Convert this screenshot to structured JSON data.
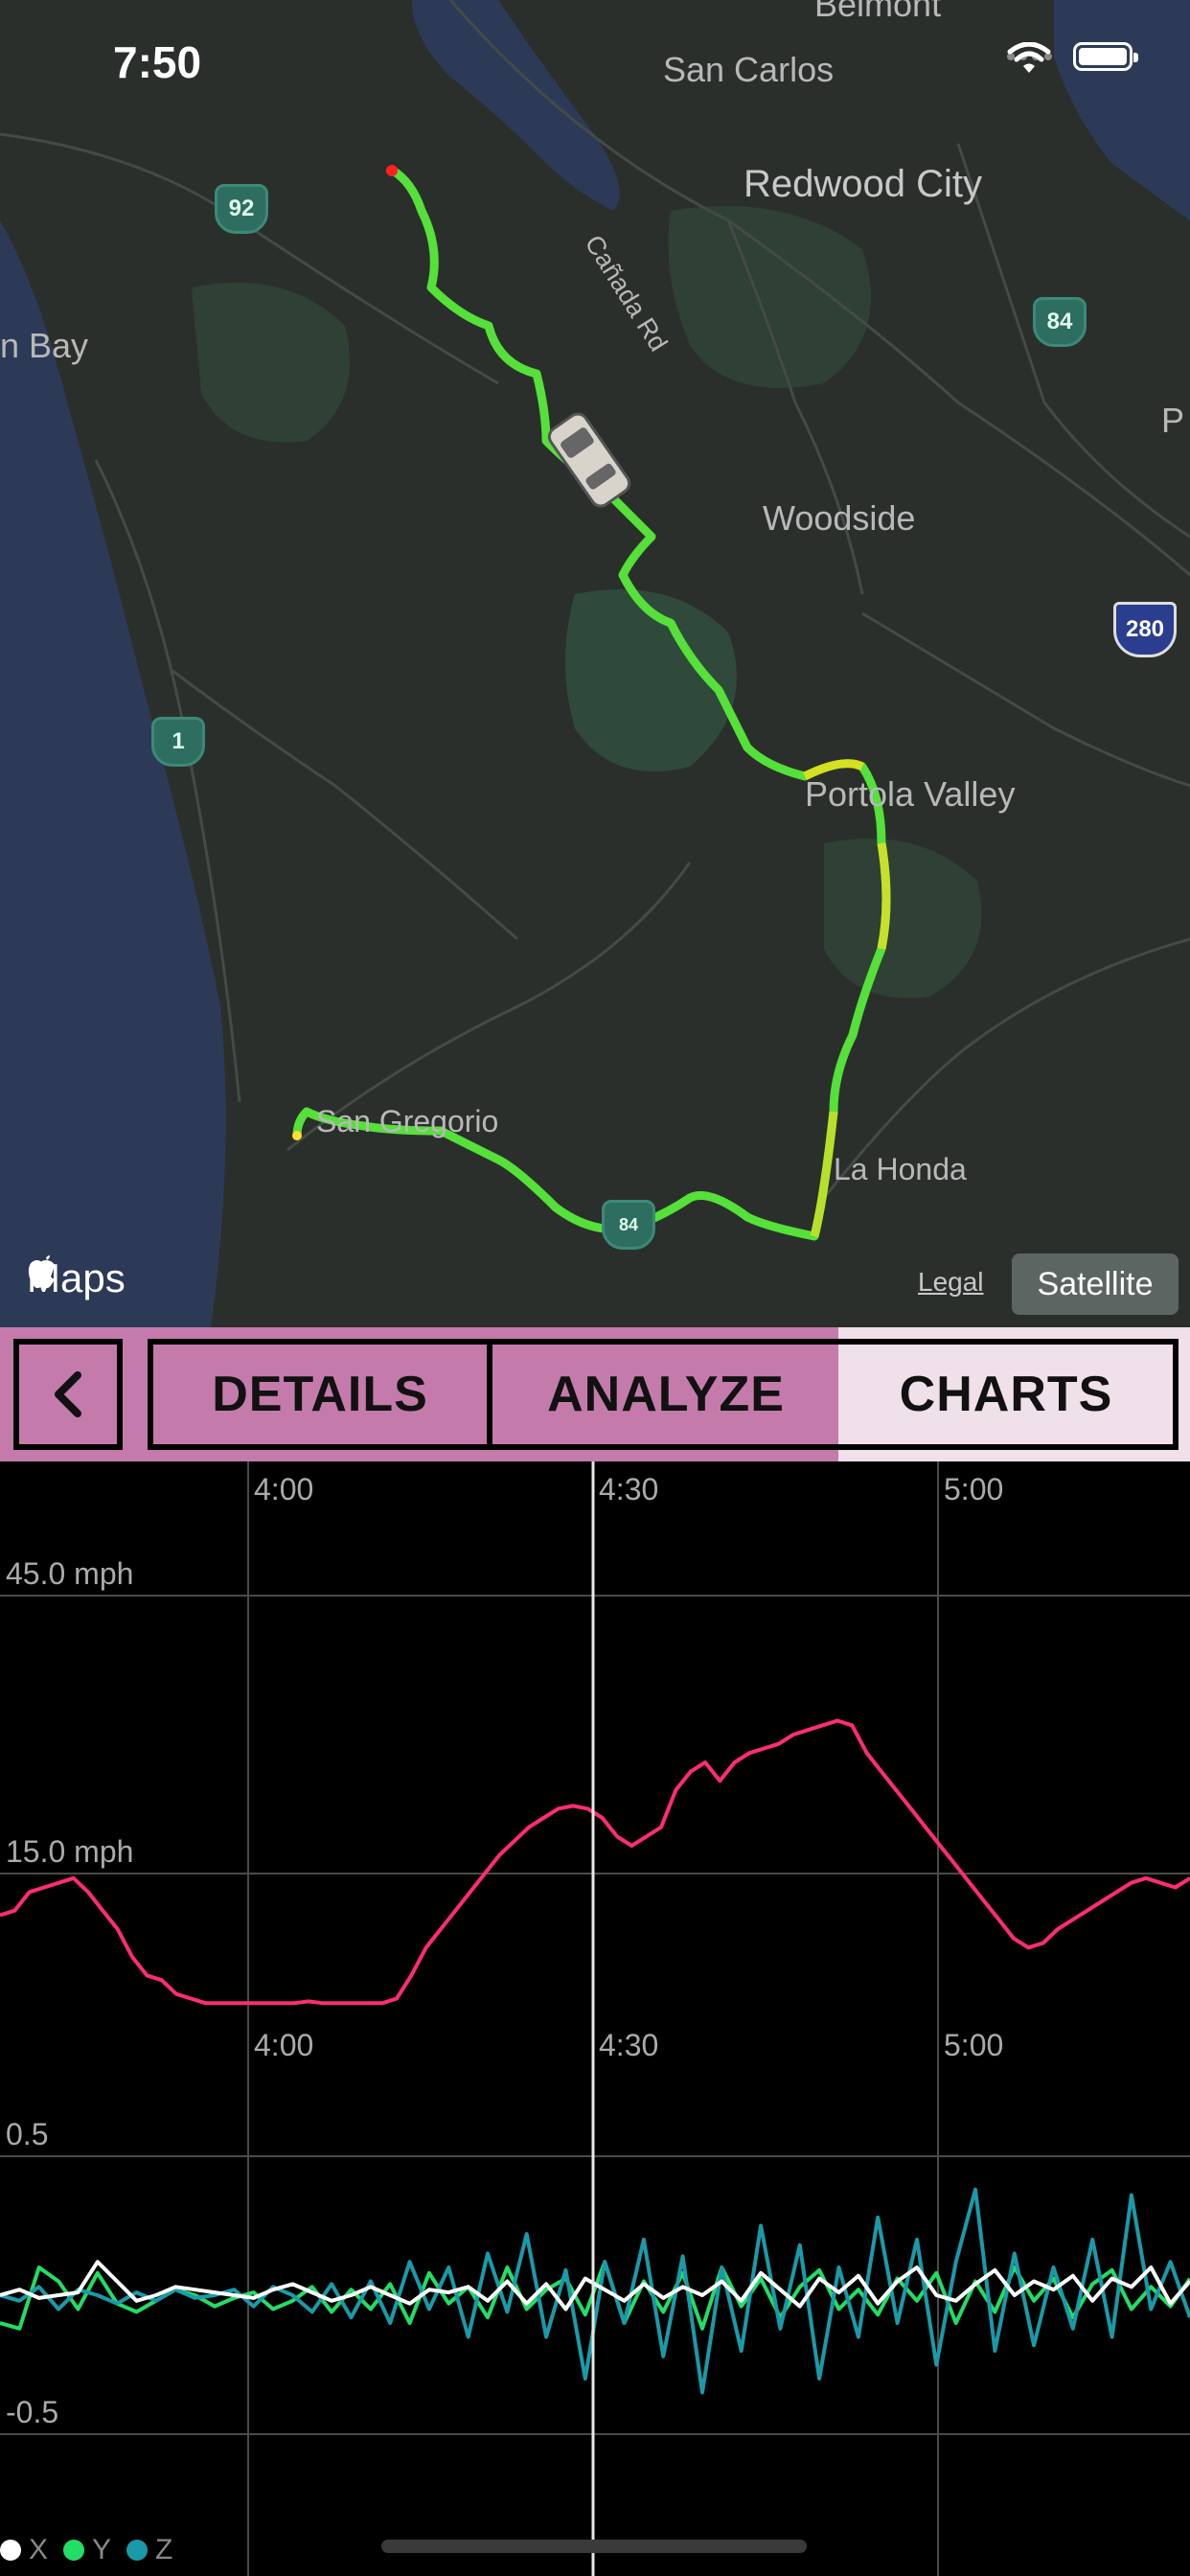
{
  "status_bar": {
    "time": "7:50"
  },
  "map": {
    "labels": {
      "belmont": "Belmont",
      "san_carlos": "San Carlos",
      "redwood_city": "Redwood City",
      "canada_rd": "Cañada Rd",
      "half_moon_bay": "n Bay",
      "woodside": "Woodside",
      "portola_valley": "Portola Valley",
      "san_gregorio": "San Gregorio",
      "la_honda": "La Honda",
      "edge_p": "P"
    },
    "shields": {
      "route92": "92",
      "route84": "84",
      "route1": "1",
      "route280": "280",
      "route84b": "84"
    },
    "logo": "Maps",
    "legal": "Legal",
    "satellite": "Satellite"
  },
  "tabs": {
    "details": "DETAILS",
    "analyze": "ANALYZE",
    "charts": "CHARTS",
    "active": "charts"
  },
  "colors": {
    "accent": "#c47bab",
    "tab_active": "#f0e0ea",
    "speed_line": "#ff2d6f",
    "x_line": "#ffffff",
    "y_line": "#22dd66",
    "z_line": "#1a9aa8",
    "grid": "#4a4a4a"
  },
  "chart_data": [
    {
      "type": "line",
      "title": "",
      "xlabel": "",
      "ylabel": "",
      "x_tick_labels": [
        "4:00",
        "4:30",
        "5:00"
      ],
      "y_tick_labels": [
        "45.0 mph",
        "15.0 mph"
      ],
      "ylim": [
        -15,
        45
      ],
      "cursor_time": "4:30",
      "series": [
        {
          "values": [
            10.5,
            11,
            13,
            13.5,
            14,
            14.5,
            13,
            11,
            9,
            6,
            4,
            3.5,
            2,
            1.5,
            1,
            1,
            1,
            1,
            1,
            1,
            1,
            1.2,
            1,
            1,
            1,
            1,
            1,
            1.5,
            4,
            7,
            9,
            11,
            13,
            15,
            17,
            18.5,
            20,
            21,
            22,
            22.3,
            22,
            21,
            19,
            18,
            19,
            20,
            24,
            26,
            27,
            25,
            27,
            28,
            28.5,
            29,
            30,
            30.5,
            31,
            31.5,
            31,
            28,
            26,
            24,
            22,
            20,
            18,
            16,
            14,
            12,
            10,
            8,
            7,
            7.5,
            9,
            10,
            11,
            12,
            13,
            14,
            14.5,
            14,
            13.5,
            14.5
          ]
        }
      ]
    },
    {
      "type": "line",
      "title": "",
      "xlabel": "",
      "ylabel": "",
      "x_tick_labels": [
        "4:00",
        "4:30",
        "5:00"
      ],
      "y_tick_labels": [
        "0.5",
        "-0.5"
      ],
      "ylim": [
        -1.0,
        0.5
      ],
      "series": [
        {
          "name": "X",
          "values": [
            0.0,
            0.02,
            -0.01,
            0.0,
            0.01,
            0.12,
            0.05,
            -0.02,
            0.0,
            0.03,
            0.02,
            0.01,
            0.0,
            -0.01,
            0.02,
            0.04,
            0.01,
            -0.02,
            0.0,
            0.03,
            0.0,
            -0.03,
            0.02,
            0.01,
            0.03,
            -0.02,
            0.05,
            -0.03,
            0.04,
            -0.05,
            0.06,
            0.02,
            -0.02,
            0.04,
            -0.01,
            0.03,
            0.0,
            0.05,
            -0.02,
            0.08,
            0.02,
            -0.04,
            0.06,
            0.01,
            0.07,
            -0.03,
            0.05,
            0.1,
            0.0,
            -0.02,
            0.04,
            0.09,
            0.0,
            0.05,
            0.02,
            0.07,
            -0.02,
            0.06,
            0.03,
            0.1,
            -0.03,
            0.05
          ]
        },
        {
          "name": "Y",
          "values": [
            -0.1,
            -0.12,
            0.1,
            0.05,
            -0.05,
            0.08,
            -0.03,
            -0.06,
            -0.02,
            0.02,
            0.0,
            -0.04,
            -0.01,
            0.01,
            -0.05,
            -0.02,
            0.03,
            -0.06,
            0.02,
            -0.05,
            0.04,
            -0.1,
            0.08,
            -0.03,
            0.03,
            -0.08,
            0.1,
            -0.05,
            0.02,
            0.06,
            -0.07,
            0.12,
            -0.1,
            0.05,
            -0.06,
            0.08,
            -0.12,
            0.1,
            -0.04,
            0.06,
            -0.08,
            0.03,
            0.09,
            -0.05,
            0.02,
            -0.07,
            0.06,
            -0.02,
            0.08,
            -0.1,
            0.05,
            -0.06,
            0.1,
            -0.02,
            0.06,
            -0.08,
            0.04,
            0.09,
            -0.05,
            0.03,
            -0.04,
            0.06
          ]
        },
        {
          "name": "Z",
          "values": [
            0.0,
            -0.02,
            0.03,
            -0.05,
            0.02,
            0.0,
            -0.03,
            0.01,
            -0.02,
            0.02,
            -0.01,
            0.0,
            0.02,
            -0.04,
            0.03,
            0.0,
            -0.06,
            0.04,
            -0.08,
            0.05,
            -0.1,
            0.12,
            -0.05,
            0.1,
            -0.15,
            0.15,
            -0.06,
            0.22,
            -0.15,
            0.09,
            -0.3,
            0.12,
            -0.1,
            0.2,
            -0.22,
            0.14,
            -0.35,
            0.1,
            -0.2,
            0.25,
            -0.12,
            0.18,
            -0.3,
            0.1,
            -0.15,
            0.28,
            -0.1,
            0.2,
            -0.25,
            0.12,
            0.38,
            -0.2,
            0.15,
            -0.18,
            0.1,
            -0.12,
            0.2,
            -0.15,
            0.36,
            -0.05,
            0.12,
            -0.08
          ]
        }
      ],
      "legend": [
        "X",
        "Y",
        "Z"
      ]
    }
  ]
}
